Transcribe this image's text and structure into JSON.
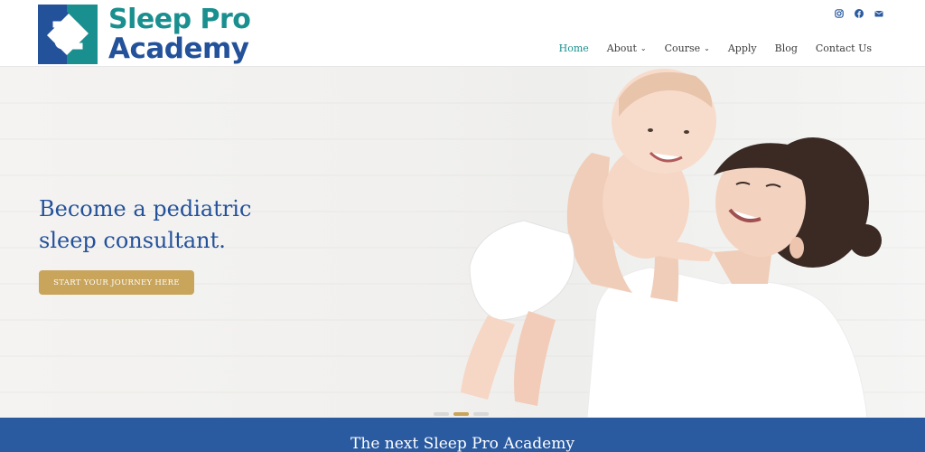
{
  "brand": {
    "line1": "Sleep Pro",
    "line2": "Academy",
    "colors": {
      "teal": "#1a8f8f",
      "blue": "#23519a",
      "gold": "#c9a45b"
    }
  },
  "social": [
    {
      "icon": "instagram-icon"
    },
    {
      "icon": "facebook-icon"
    },
    {
      "icon": "envelope-icon"
    }
  ],
  "nav": {
    "items": [
      {
        "label": "Home",
        "active": true
      },
      {
        "label": "About",
        "dropdown": true
      },
      {
        "label": "Course",
        "dropdown": true
      },
      {
        "label": "Apply"
      },
      {
        "label": "Blog"
      },
      {
        "label": "Contact Us"
      }
    ],
    "chevron": "⌄"
  },
  "hero": {
    "title_line1": "Become a pediatric",
    "title_line2": "sleep consultant.",
    "button": "START YOUR JOURNEY HERE",
    "slider": {
      "count": 3,
      "active_index": 1
    }
  },
  "band": {
    "text": "The next Sleep Pro Academy"
  }
}
